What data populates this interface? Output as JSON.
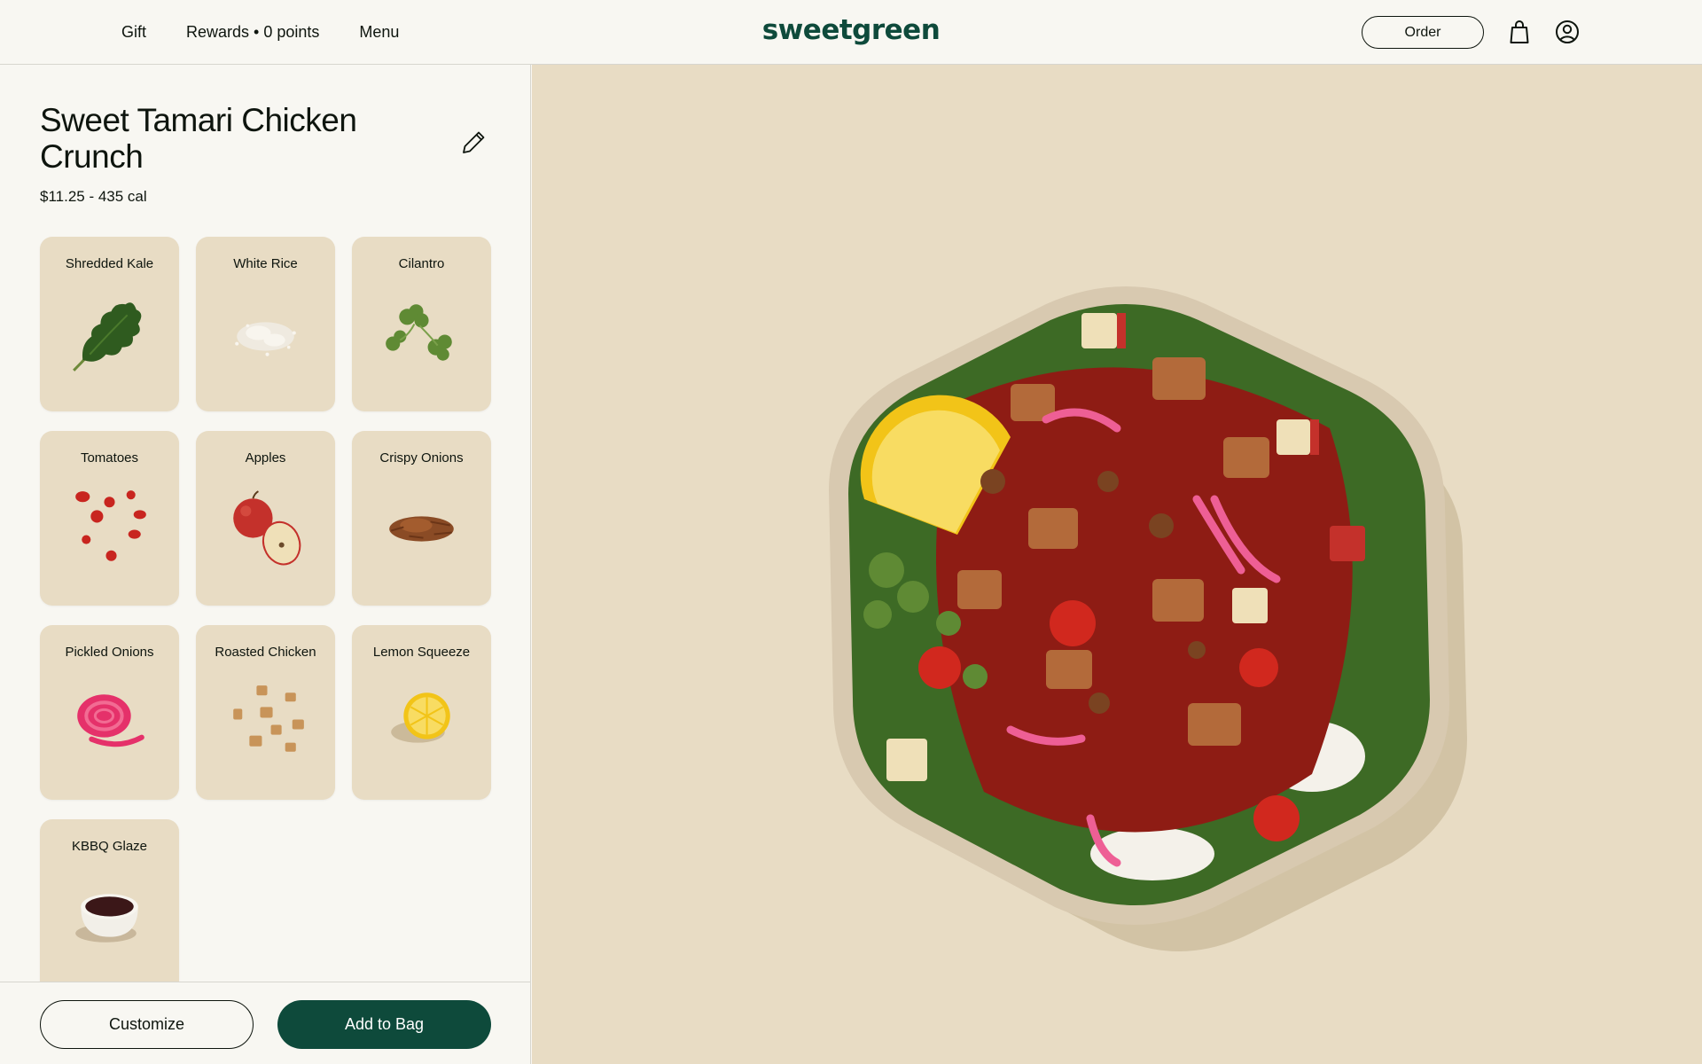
{
  "header": {
    "nav": [
      {
        "label": "Gift"
      },
      {
        "label": "Rewards • 0 points"
      },
      {
        "label": "Menu"
      }
    ],
    "logo": "sweetgreen",
    "order_label": "Order",
    "icons": [
      "bag-icon",
      "account-icon"
    ]
  },
  "product": {
    "title": "Sweet Tamari Chicken Crunch",
    "price_cal": "$11.25 - 435 cal",
    "edit_icon": "pencil-icon"
  },
  "ingredients": [
    {
      "label": "Shredded Kale",
      "icon": "kale-image"
    },
    {
      "label": "White Rice",
      "icon": "rice-image"
    },
    {
      "label": "Cilantro",
      "icon": "cilantro-image"
    },
    {
      "label": "Tomatoes",
      "icon": "tomatoes-image"
    },
    {
      "label": "Apples",
      "icon": "apples-image"
    },
    {
      "label": "Crispy Onions",
      "icon": "crispy-onions-image"
    },
    {
      "label": "Pickled Onions",
      "icon": "pickled-onions-image"
    },
    {
      "label": "Roasted Chicken",
      "icon": "roasted-chicken-image"
    },
    {
      "label": "Lemon Squeeze",
      "icon": "lemon-image"
    },
    {
      "label": "KBBQ Glaze",
      "icon": "sauce-image"
    }
  ],
  "actions": {
    "customize_label": "Customize",
    "add_to_bag_label": "Add to Bag"
  },
  "colors": {
    "brand_green": "#0e4a3b",
    "card_bg": "#e8dcc4",
    "page_bg": "#f8f7f2",
    "text": "#0e150e"
  }
}
